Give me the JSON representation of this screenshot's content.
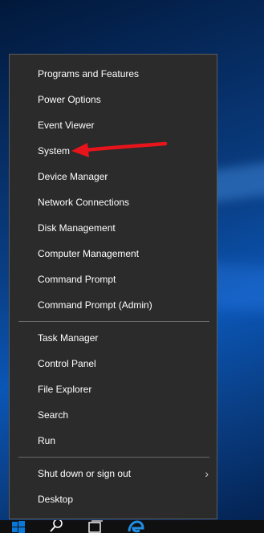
{
  "menu": {
    "items": [
      {
        "label": "Programs and Features"
      },
      {
        "label": "Power Options"
      },
      {
        "label": "Event Viewer"
      },
      {
        "label": "System"
      },
      {
        "label": "Device Manager"
      },
      {
        "label": "Network Connections"
      },
      {
        "label": "Disk Management"
      },
      {
        "label": "Computer Management"
      },
      {
        "label": "Command Prompt"
      },
      {
        "label": "Command Prompt (Admin)"
      },
      {
        "label": "Task Manager"
      },
      {
        "label": "Control Panel"
      },
      {
        "label": "File Explorer"
      },
      {
        "label": "Search"
      },
      {
        "label": "Run"
      },
      {
        "label": "Shut down or sign out"
      },
      {
        "label": "Desktop"
      }
    ],
    "submenu_indicator": "›"
  },
  "annotation": {
    "arrow_color": "#e8141c",
    "points_to": "System"
  },
  "taskbar": {
    "icons": [
      "windows-start-icon",
      "search-icon",
      "task-view-icon",
      "edge-browser-icon"
    ]
  },
  "colors": {
    "menu_background": "#2b2b2b",
    "menu_text": "#ffffff",
    "separator": "#6a6a6a",
    "accent": "#0078d7"
  }
}
